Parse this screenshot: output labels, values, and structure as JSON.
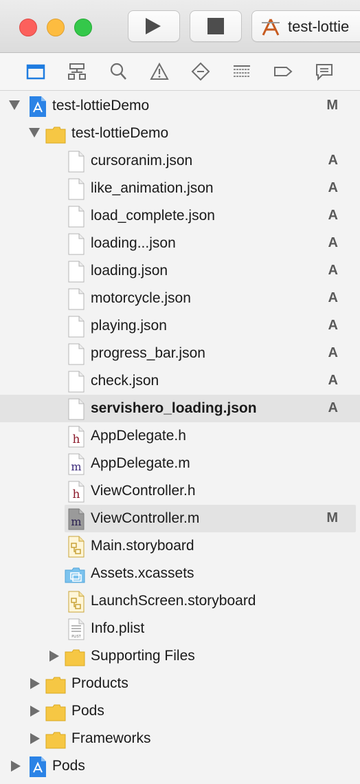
{
  "window": {
    "scheme_label": "test-lottie",
    "controls": [
      "close",
      "minimize",
      "zoom"
    ]
  },
  "toolbar": {
    "run_icon": "play-icon",
    "stop_icon": "stop-icon",
    "scheme_icon": "xcode-app-icon"
  },
  "navigator_tabs": [
    {
      "name": "project-navigator-icon",
      "active": true
    },
    {
      "name": "symbol-navigator-icon"
    },
    {
      "name": "find-navigator-icon"
    },
    {
      "name": "issue-navigator-icon"
    },
    {
      "name": "test-navigator-icon"
    },
    {
      "name": "debug-navigator-icon"
    },
    {
      "name": "breakpoint-navigator-icon"
    },
    {
      "name": "report-navigator-icon"
    }
  ],
  "tree": [
    {
      "name": "test-lottieDemo",
      "status": "M"
    },
    {
      "name": "test-lottieDemo",
      "status": ""
    },
    {
      "name": "cursoranim.json",
      "status": "A"
    },
    {
      "name": "like_animation.json",
      "status": "A"
    },
    {
      "name": "load_complete.json",
      "status": "A"
    },
    {
      "name": "loading...json",
      "status": "A"
    },
    {
      "name": "loading.json",
      "status": "A"
    },
    {
      "name": "motorcycle.json",
      "status": "A"
    },
    {
      "name": "playing.json",
      "status": "A"
    },
    {
      "name": "progress_bar.json",
      "status": "A"
    },
    {
      "name": "check.json",
      "status": "A"
    },
    {
      "name": "servishero_loading.json",
      "status": "A"
    },
    {
      "name": "AppDelegate.h",
      "status": ""
    },
    {
      "name": "AppDelegate.m",
      "status": ""
    },
    {
      "name": "ViewController.h",
      "status": ""
    },
    {
      "name": "ViewController.m",
      "status": "M"
    },
    {
      "name": "Main.storyboard",
      "status": ""
    },
    {
      "name": "Assets.xcassets",
      "status": ""
    },
    {
      "name": "LaunchScreen.storyboard",
      "status": ""
    },
    {
      "name": "Info.plist",
      "status": ""
    },
    {
      "name": "Supporting Files",
      "status": ""
    },
    {
      "name": "Products",
      "status": ""
    },
    {
      "name": "Pods",
      "status": ""
    },
    {
      "name": "Frameworks",
      "status": ""
    },
    {
      "name": "Pods",
      "status": ""
    }
  ],
  "icon_glyphs": {
    "header": "h",
    "implementation": "m",
    "plist": "PLIST"
  },
  "colors": {
    "accent": "#1f7ce0",
    "folder": "#f6c744",
    "selection": "#e3e3e3"
  }
}
